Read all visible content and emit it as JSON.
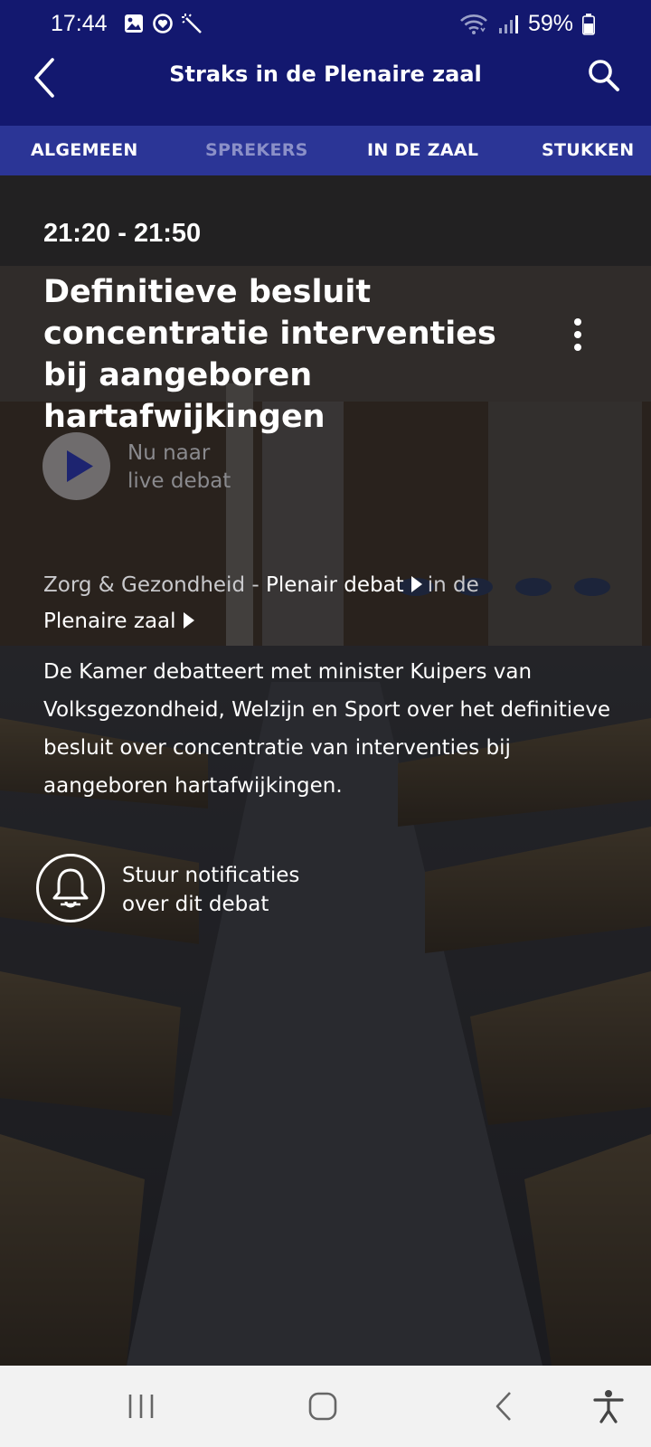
{
  "status_bar": {
    "time": "17:44",
    "battery": "59%",
    "icons": [
      "gallery-icon",
      "heart-sync-icon",
      "magic-wand-icon",
      "wifi-icon",
      "signal-icon",
      "battery-icon"
    ]
  },
  "app_bar": {
    "title": "Straks in de Plenaire zaal",
    "back_icon": "chevron-left-icon",
    "search_icon": "search-icon",
    "color": "#13186f"
  },
  "tabs": [
    {
      "label": "ALGEMEEN",
      "active": true
    },
    {
      "label": "SPREKERS",
      "active": false
    },
    {
      "label": "IN DE ZAAL",
      "active": false
    },
    {
      "label": "STUKKEN",
      "active": false
    }
  ],
  "debate": {
    "time_range": "21:20 - 21:50",
    "title": "Definitieve besluit concentratie interventies bij aangeboren hartafwijkingen",
    "live_button": {
      "line1": "Nu naar",
      "line2": "live debat"
    },
    "meta": {
      "topic": "Zorg & Gezondheid",
      "separator": " - ",
      "type_link": "Plenair debat",
      "connector": "in de",
      "location_link": "Plenaire zaal"
    },
    "description": "De Kamer debatteert met minister Kuipers van Volksgezondheid, Welzijn en Sport over het definitieve besluit over concentratie van interventies bij aangeboren hartafwijkingen.",
    "notification": {
      "line1": "Stuur notificaties",
      "line2": "over dit debat"
    }
  },
  "system_nav": [
    "recents-icon",
    "home-icon",
    "back-icon",
    "accessibility-icon"
  ]
}
